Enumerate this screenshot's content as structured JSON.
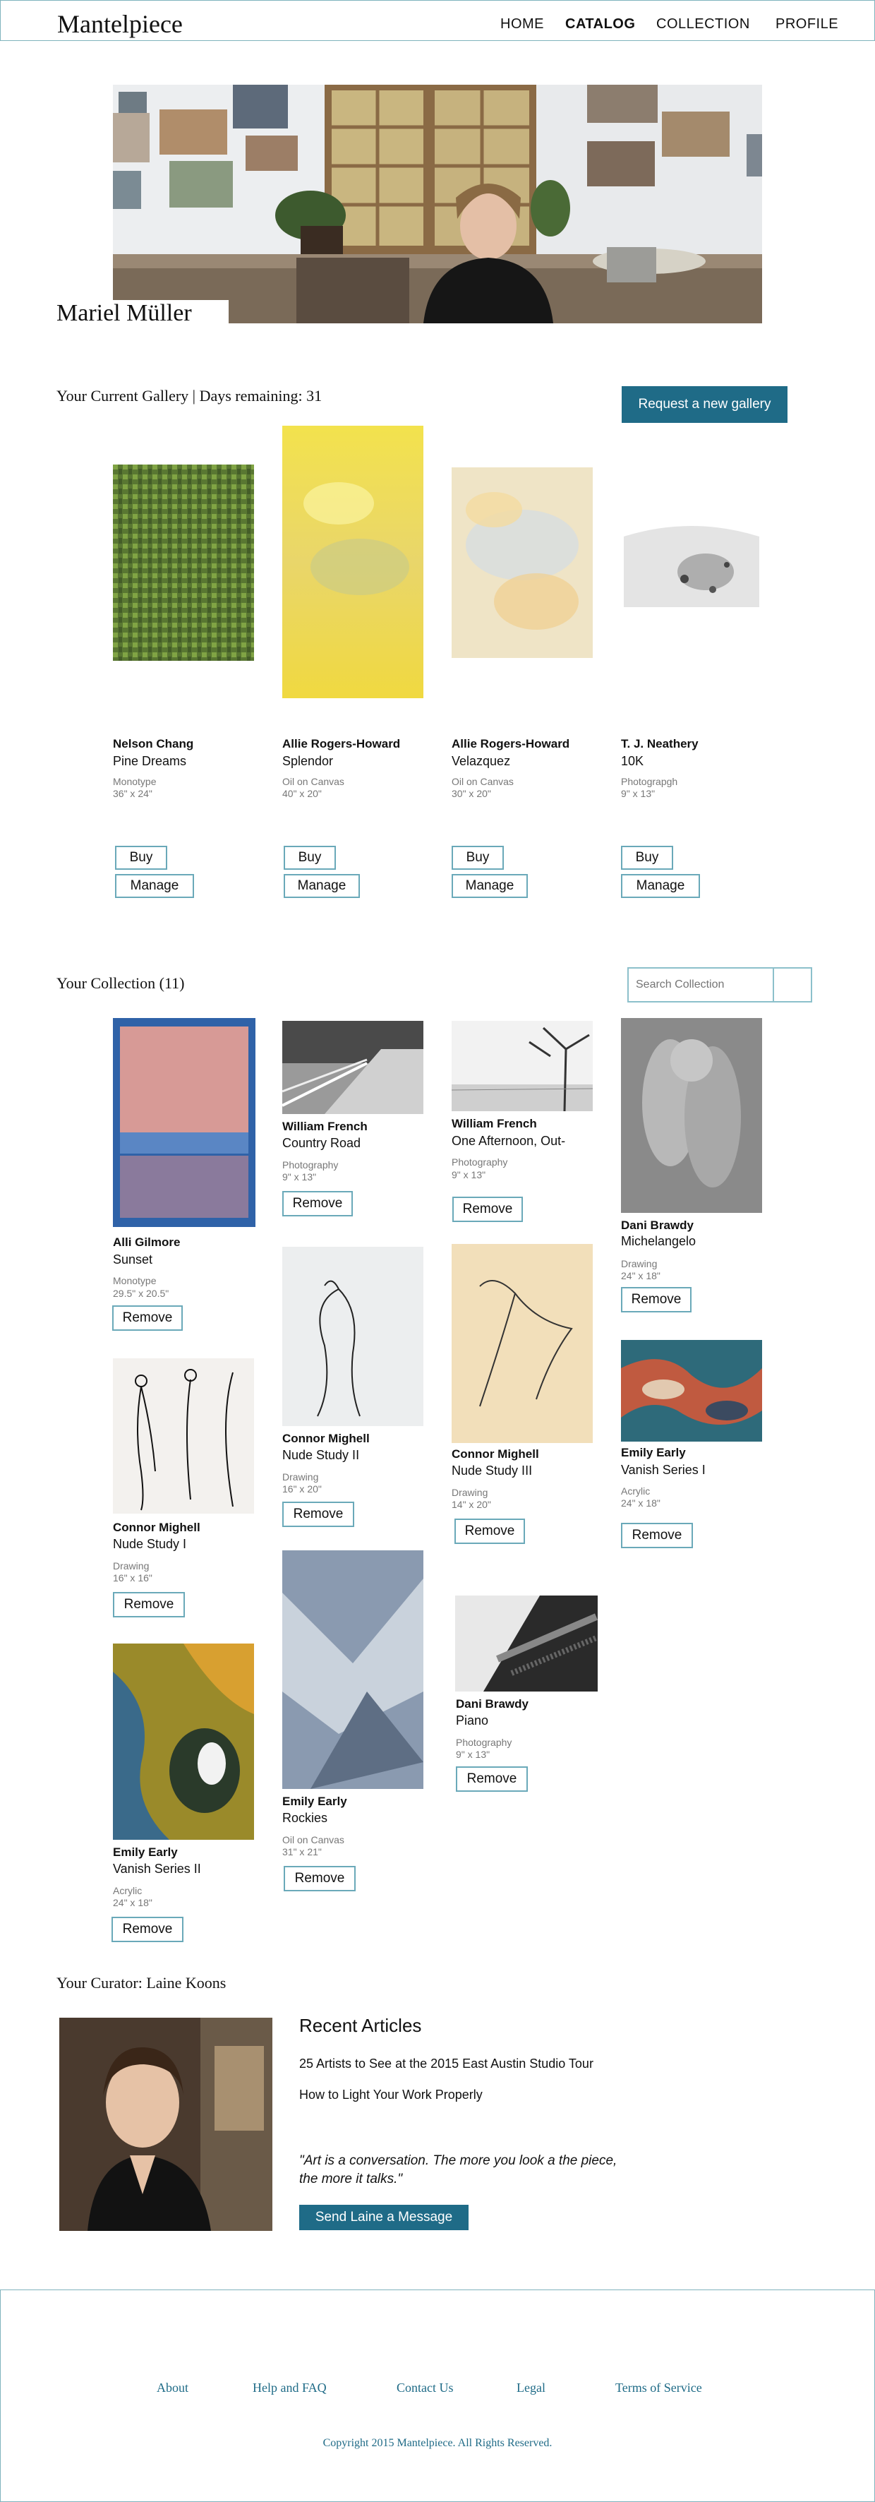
{
  "header": {
    "logo": "Mantelpiece",
    "nav": [
      "HOME",
      "CATALOG",
      "COLLECTION",
      "PROFILE"
    ],
    "active_nav": "CATALOG"
  },
  "artist": {
    "name": "Mariel Müller"
  },
  "gallery": {
    "title": "Your Current Gallery | Days remaining: 31",
    "request_label": "Request a new gallery",
    "buy_label": "Buy",
    "manage_label": "Manage",
    "items": [
      {
        "artist": "Nelson Chang",
        "title": "Pine Dreams",
        "medium": "Monotype",
        "size": "36\" x 24\""
      },
      {
        "artist": "Allie Rogers-Howard",
        "title": "Splendor",
        "medium": "Oil on Canvas",
        "size": "40\" x 20\""
      },
      {
        "artist": "Allie Rogers-Howard",
        "title": "Velazquez",
        "medium": "Oil on Canvas",
        "size": "30\" x 20\""
      },
      {
        "artist": "T. J. Neathery",
        "title": "10K",
        "medium": "Photograpgh",
        "size": "9\" x 13\""
      }
    ]
  },
  "collection": {
    "title": "Your Collection (11)",
    "search_placeholder": "Search Collection",
    "remove_label": "Remove",
    "items": [
      {
        "artist": "Alli Gilmore",
        "title": "Sunset",
        "medium": "Monotype",
        "size": "29.5\" x 20.5\""
      },
      {
        "artist": "William French",
        "title": "Country Road",
        "medium": "Photography",
        "size": "9\" x 13\""
      },
      {
        "artist": "William French",
        "title": "One Afternoon, Out-",
        "medium": "Photography",
        "size": "9\" x 13\""
      },
      {
        "artist": "Dani Brawdy",
        "title": "Michelangelo",
        "medium": "Drawing",
        "size": "24\" x 18\""
      },
      {
        "artist": "Connor Mighell",
        "title": "Nude  Study II",
        "medium": "Drawing",
        "size": "16\" x 20\""
      },
      {
        "artist": "Connor Mighell",
        "title": "Nude Study III",
        "medium": "Drawing",
        "size": "14\" x 20\""
      },
      {
        "artist": "Emily Early",
        "title": "Vanish Series I",
        "medium": "Acrylic",
        "size": "24\" x 18\""
      },
      {
        "artist": "Connor Mighell",
        "title": "Nude Study I",
        "medium": "Drawing",
        "size": "16\" x 16\""
      },
      {
        "artist": "Emily Early",
        "title": "Rockies",
        "medium": "Oil on Canvas",
        "size": "31\" x 21\""
      },
      {
        "artist": "Dani Brawdy",
        "title": "Piano",
        "medium": "Photography",
        "size": "9\" x 13\""
      },
      {
        "artist": "Emily Early",
        "title": "Vanish Series II",
        "medium": "Acrylic",
        "size": "24\" x 18\""
      }
    ]
  },
  "curator": {
    "title": "Your Curator: Laine Koons",
    "articles_heading": "Recent Articles",
    "articles": [
      "25 Artists to See at the 2015  East Austin Studio Tour",
      "How to Light Your Work Properly"
    ],
    "quote": "\"Art is a conversation. The more you look a the piece, the more it talks.\"",
    "message_label": "Send Laine a Message"
  },
  "footer": {
    "links": [
      "About",
      "Help and FAQ",
      "Contact Us",
      "Legal",
      "Terms of Service"
    ],
    "copyright": "Copyright 2015 Mantelpiece. All Rights Reserved."
  },
  "colors": {
    "accent": "#1f6b87",
    "border": "#7fb3bd"
  }
}
